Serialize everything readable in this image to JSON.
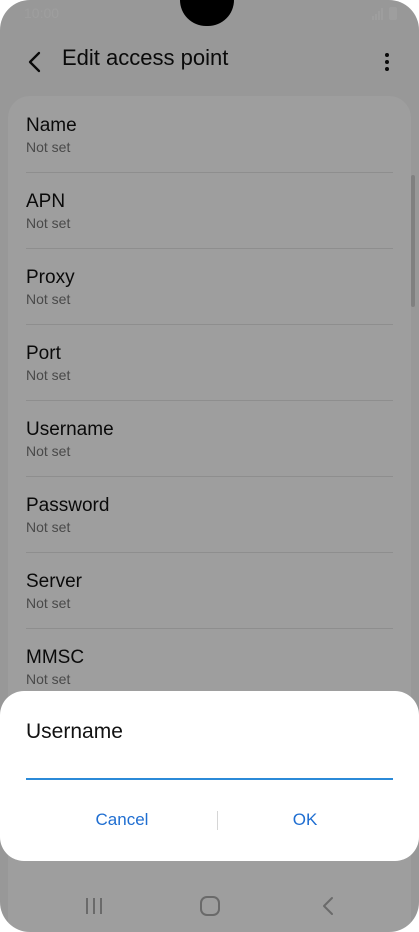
{
  "status_bar": {
    "time": "10:00"
  },
  "app_bar": {
    "title": "Edit access point"
  },
  "settings": [
    {
      "label": "Name",
      "value": "Not set"
    },
    {
      "label": "APN",
      "value": "Not set"
    },
    {
      "label": "Proxy",
      "value": "Not set"
    },
    {
      "label": "Port",
      "value": "Not set"
    },
    {
      "label": "Username",
      "value": "Not set"
    },
    {
      "label": "Password",
      "value": "Not set"
    },
    {
      "label": "Server",
      "value": "Not set"
    },
    {
      "label": "MMSC",
      "value": "Not set"
    }
  ],
  "dialog": {
    "title": "Username",
    "input_value": "",
    "cancel_label": "Cancel",
    "ok_label": "OK"
  },
  "icons": {
    "back": "chevron-left-icon",
    "more": "more-vertical-icon",
    "recents": "recents-icon",
    "home": "home-icon",
    "nav_back": "nav-back-icon"
  },
  "colors": {
    "accent": "#1f6ed1",
    "input_underline": "#2b8ad8"
  }
}
